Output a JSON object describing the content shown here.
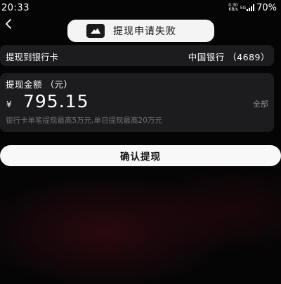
{
  "status_bar": {
    "time": "20:33",
    "net_speed_value": "0.30",
    "net_speed_unit": "KB/s",
    "signal_label": "5G",
    "battery": "70%"
  },
  "toast": {
    "icon": "app-logo-icon",
    "message": "提现申请失败"
  },
  "bank_row": {
    "label": "提现到银行卡",
    "value": "中国银行 （4689）"
  },
  "amount_section": {
    "title": "提现金额 （元）",
    "currency_symbol": "¥",
    "amount": "795.15",
    "withdraw_all_label": "全部",
    "limit_note": "银行卡单笔提现最高5万元,单日提现最高20万元"
  },
  "confirm_button": {
    "label": "确认提现"
  },
  "colors": {
    "background": "#050506",
    "card": "#1c1c1f",
    "toast_bg": "#f4f4f4",
    "button_bg": "#f8f8f8",
    "muted_text": "#8a8a8a"
  }
}
